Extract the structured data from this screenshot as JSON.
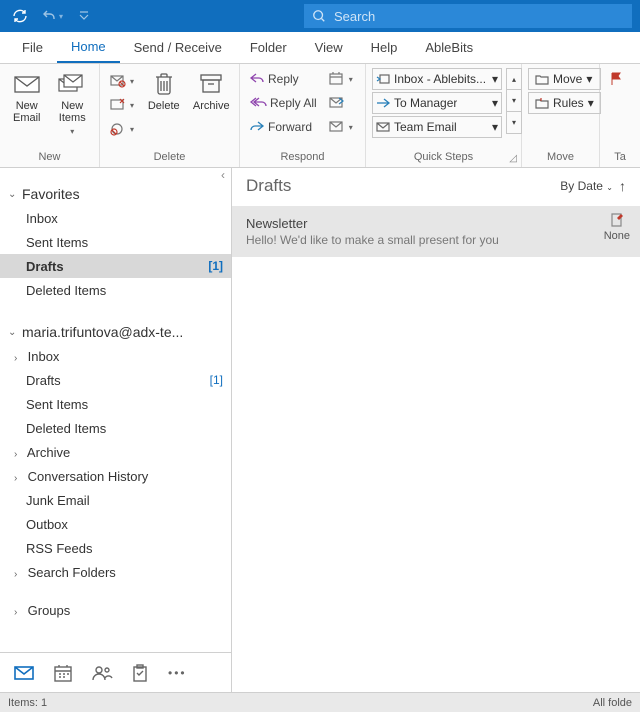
{
  "search": {
    "placeholder": "Search"
  },
  "menu": {
    "file": "File",
    "home": "Home",
    "sendreceive": "Send / Receive",
    "folder": "Folder",
    "view": "View",
    "help": "Help",
    "ablebits": "AbleBits"
  },
  "ribbon": {
    "new": {
      "label": "New",
      "new_email": "New\nEmail",
      "new_items": "New\nItems"
    },
    "delete": {
      "label": "Delete",
      "delete_btn": "Delete",
      "archive_btn": "Archive"
    },
    "respond": {
      "label": "Respond",
      "reply": "Reply",
      "reply_all": "Reply All",
      "forward": "Forward"
    },
    "quicksteps": {
      "label": "Quick Steps",
      "items": [
        "Inbox - Ablebits...",
        "To Manager",
        "Team Email"
      ]
    },
    "move": {
      "label": "Move",
      "move_btn": "Move",
      "rules_btn": "Rules"
    },
    "tags": {
      "label": "Ta"
    }
  },
  "nav": {
    "favorites": {
      "title": "Favorites",
      "items": [
        {
          "label": "Inbox",
          "count": ""
        },
        {
          "label": "Sent Items",
          "count": ""
        },
        {
          "label": "Drafts",
          "count": "[1]",
          "selected": true
        },
        {
          "label": "Deleted Items",
          "count": ""
        }
      ]
    },
    "account": {
      "title": "maria.trifuntova@adx-te...",
      "items": [
        {
          "label": "Inbox",
          "chev": true
        },
        {
          "label": "Drafts",
          "count": "[1]"
        },
        {
          "label": "Sent Items"
        },
        {
          "label": "Deleted Items"
        },
        {
          "label": "Archive",
          "chev": true
        },
        {
          "label": "Conversation History",
          "chev": true
        },
        {
          "label": "Junk Email"
        },
        {
          "label": "Outbox"
        },
        {
          "label": "RSS Feeds"
        },
        {
          "label": "Search Folders",
          "chev": true
        }
      ]
    },
    "groups": {
      "title": "Groups"
    }
  },
  "content": {
    "title": "Drafts",
    "sort": "By Date",
    "message": {
      "subject": "Newsletter",
      "preview": "Hello!  We'd like to make a small present for you",
      "flag": "None"
    }
  },
  "status": {
    "left": "Items: 1",
    "right": "All folde"
  }
}
